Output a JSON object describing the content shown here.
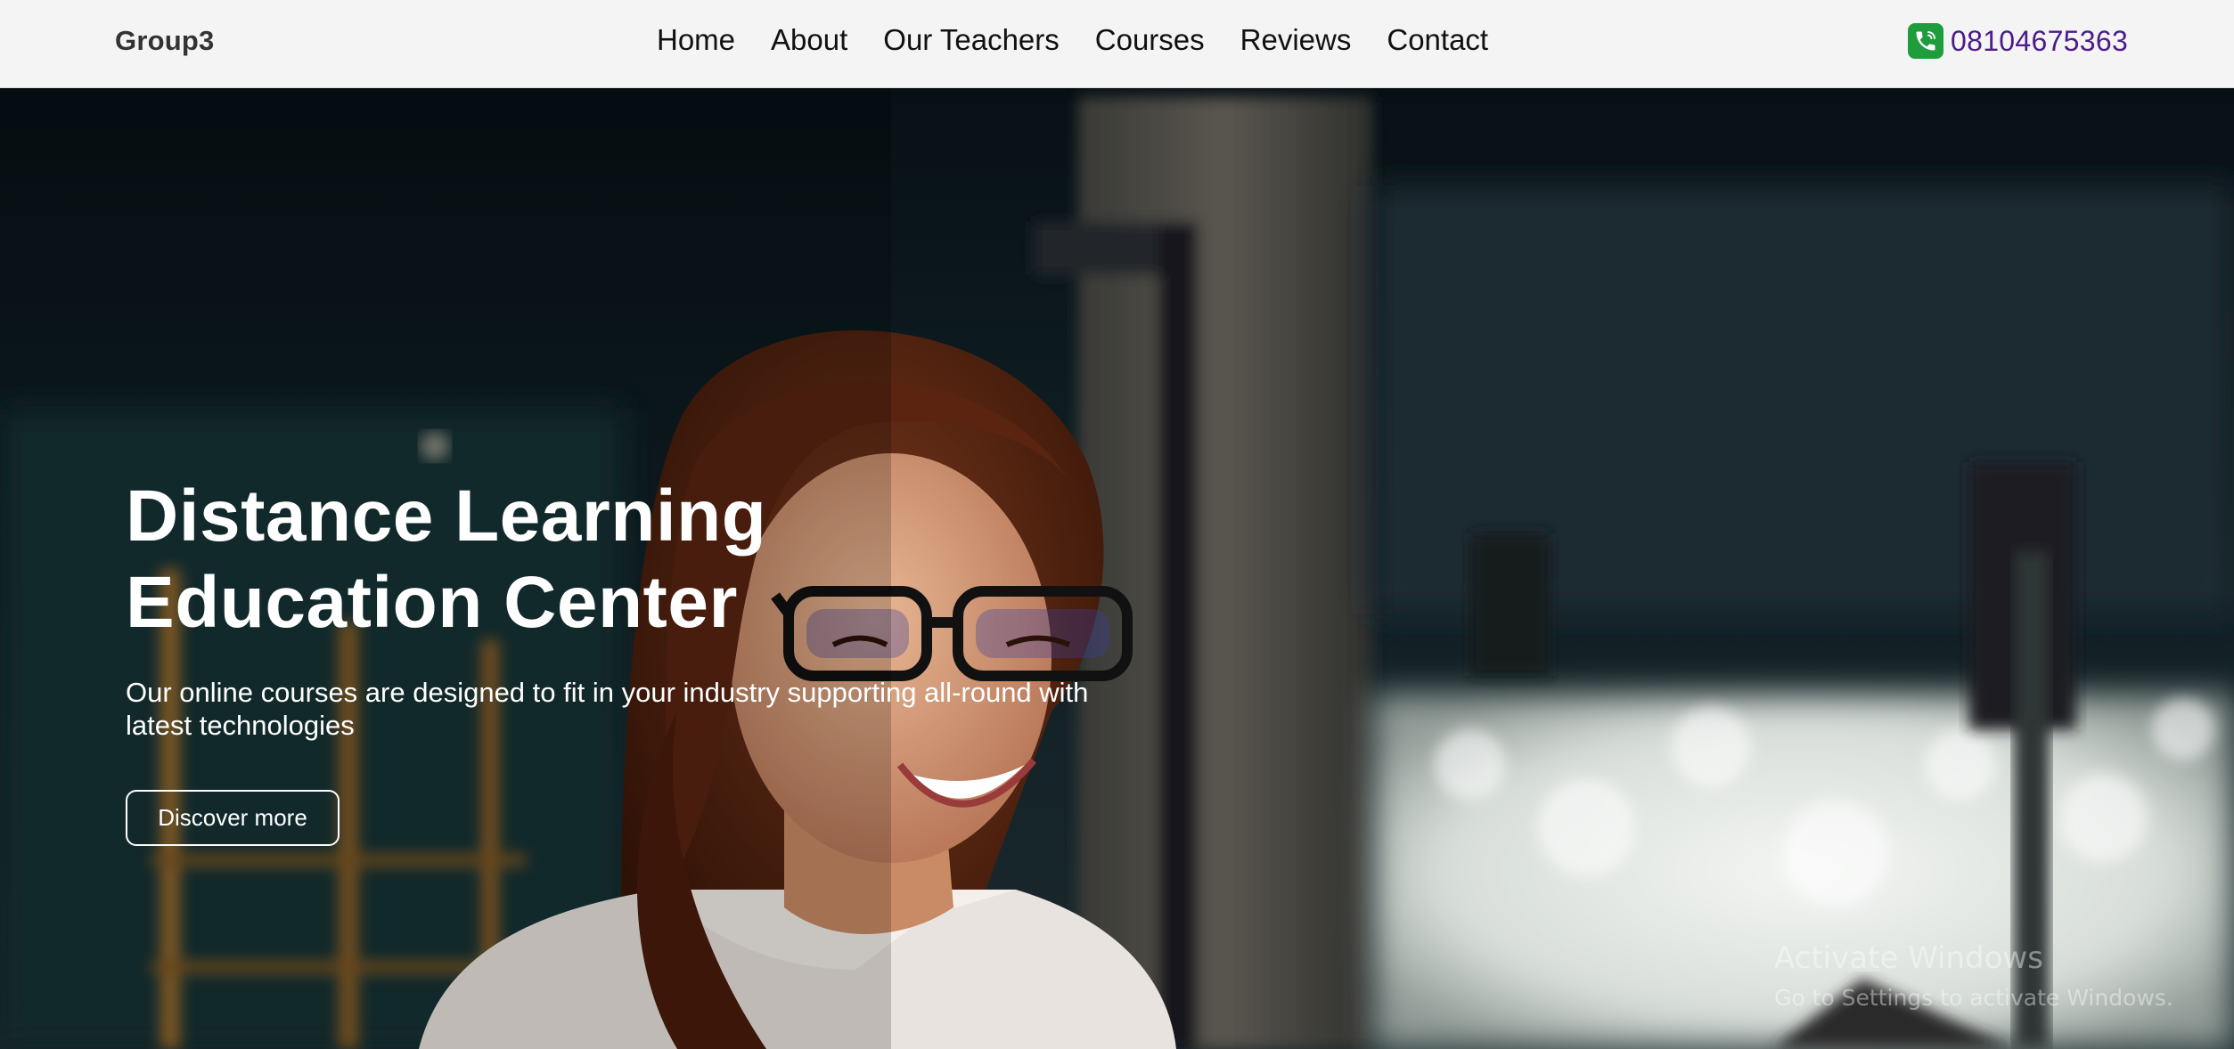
{
  "brand": "Group3",
  "nav": {
    "items": [
      "Home",
      "About",
      "Our Teachers",
      "Courses",
      "Reviews",
      "Contact"
    ]
  },
  "contact": {
    "phone": "08104675363",
    "icon": "phone-icon"
  },
  "hero": {
    "title_line1": "Distance Learning",
    "title_line2": "Education Center",
    "subtitle": "Our online courses are designed to fit in your industry supporting all-round with latest technologies",
    "button_label": "Discover more"
  },
  "watermark": {
    "title": "Activate Windows",
    "subtitle": "Go to Settings to activate Windows."
  },
  "colors": {
    "header_bg": "#f4f4f4",
    "phone_text": "#4b1b8a",
    "phone_icon_bg": "#1f9d3c",
    "hero_text": "#ffffff"
  }
}
